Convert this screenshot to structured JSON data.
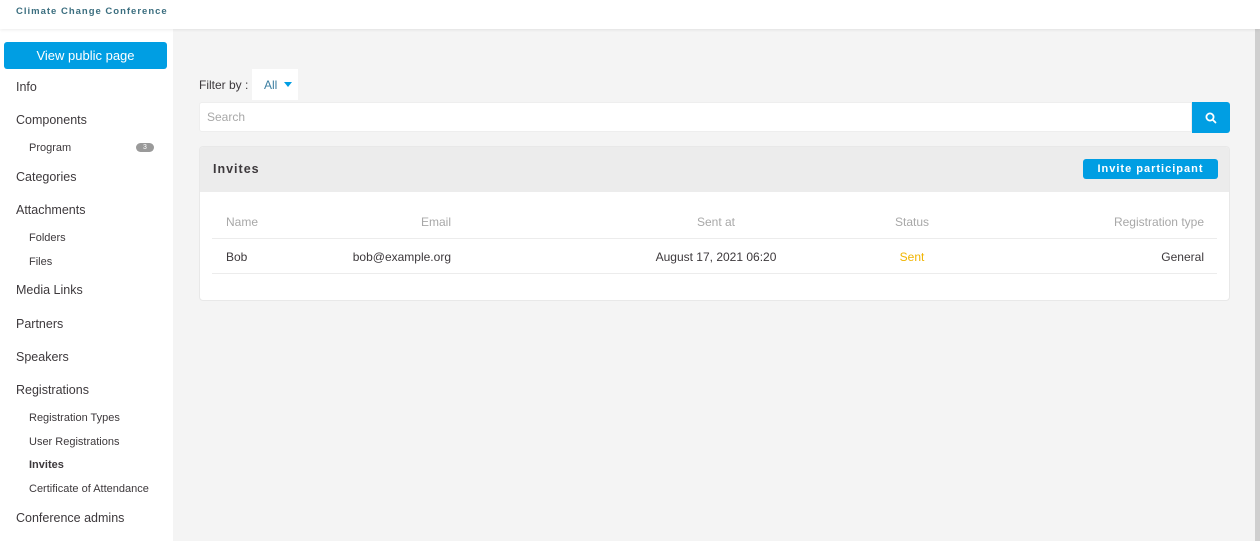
{
  "app": {
    "title": "Climate Change Conference"
  },
  "sidebar": {
    "view_public_label": "View public page",
    "items": [
      {
        "label": "Info"
      },
      {
        "label": "Components"
      },
      {
        "label": "Program",
        "badge": "3"
      },
      {
        "label": "Categories"
      },
      {
        "label": "Attachments"
      },
      {
        "label": "Folders"
      },
      {
        "label": "Files"
      },
      {
        "label": "Media Links"
      },
      {
        "label": "Partners"
      },
      {
        "label": "Speakers"
      },
      {
        "label": "Registrations"
      },
      {
        "label": "Registration Types"
      },
      {
        "label": "User Registrations"
      },
      {
        "label": "Invites",
        "active": true
      },
      {
        "label": "Certificate of Attendance"
      },
      {
        "label": "Conference admins"
      }
    ]
  },
  "filter": {
    "label": "Filter by :",
    "selected": "All"
  },
  "search": {
    "placeholder": "Search",
    "value": "",
    "icon": "search-icon"
  },
  "invites": {
    "title": "Invites",
    "invite_button_label": "Invite participant",
    "columns": [
      "Name",
      "Email",
      "Sent at",
      "Status",
      "Registration type"
    ],
    "rows": [
      {
        "name": "Bob",
        "email": "bob@example.org",
        "sent_at": "August 17, 2021 06:20",
        "status": "Sent",
        "registration_type": "General"
      }
    ]
  },
  "colors": {
    "accent": "#009ee3",
    "status_sent": "#f0b400",
    "brand": "#3b6e7f"
  }
}
